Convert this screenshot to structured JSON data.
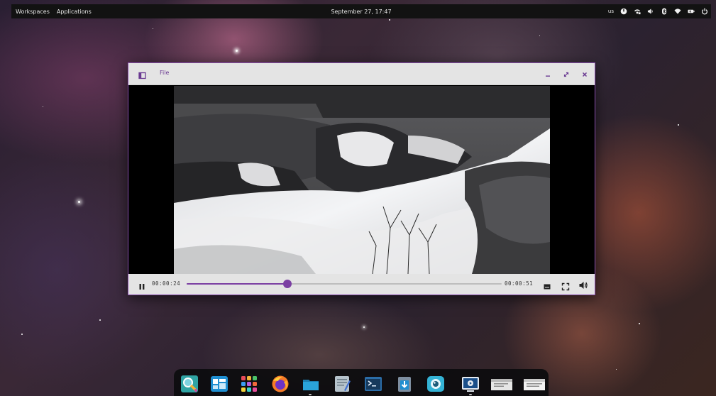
{
  "topbar": {
    "workspaces_label": "Workspaces",
    "applications_label": "Applications",
    "clock": "September 27, 17:47",
    "keyboard_layout": "us",
    "tray_icons": [
      "power-icon",
      "network-icon",
      "volume-icon",
      "bluetooth-icon",
      "wifi-icon",
      "battery-icon",
      "power-off-icon"
    ]
  },
  "window": {
    "menu_label": "File",
    "controls": [
      "minimize-icon",
      "maximize-icon",
      "close-icon"
    ]
  },
  "player": {
    "current_time": "00:00:24",
    "total_time": "00:00:51",
    "progress_fraction": 0.32,
    "accent_color": "#7b3fa3"
  },
  "dock": {
    "apps": [
      "image-viewer-icon",
      "workspace-manager-icon",
      "app-grid-icon",
      "firefox-icon",
      "files-icon",
      "text-editor-icon",
      "terminal-icon",
      "installer-icon",
      "camera-icon",
      "video-player-icon",
      "window-preview-icon",
      "window-preview-icon"
    ]
  }
}
